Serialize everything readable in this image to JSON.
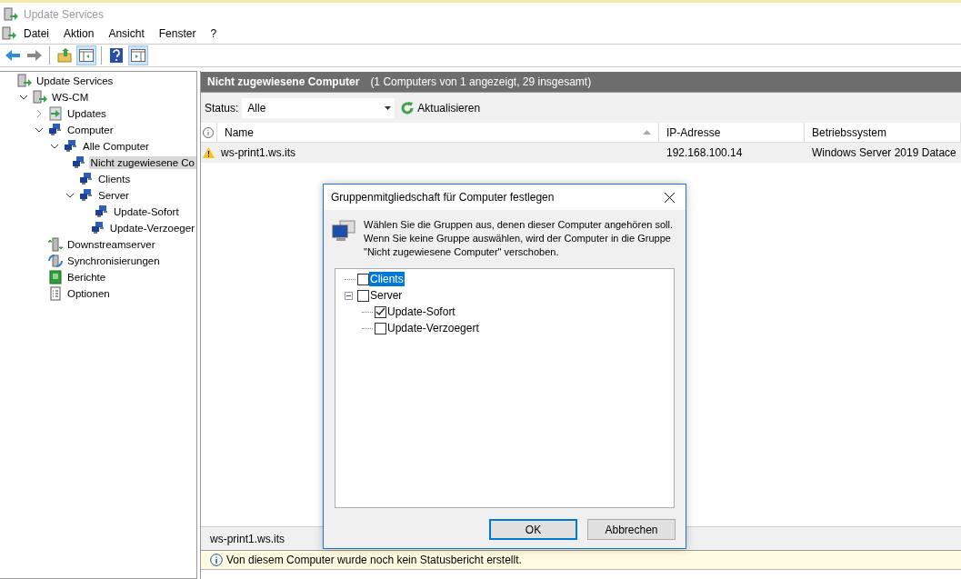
{
  "window": {
    "title": "Update Services"
  },
  "menu": [
    "Datei",
    "Aktion",
    "Ansicht",
    "Fenster",
    "?"
  ],
  "toolbar": [
    {
      "kind": "back",
      "selected": false
    },
    {
      "kind": "forward",
      "selected": false
    },
    {
      "kind": "up",
      "selected": false
    },
    {
      "kind": "pane",
      "selected": true
    },
    {
      "kind": "help",
      "selected": false
    },
    {
      "kind": "action",
      "selected": true
    }
  ],
  "tree": [
    {
      "label": "Update Services",
      "kind": "server",
      "selected": false,
      "children": [
        {
          "label": "WS-CM",
          "kind": "server",
          "selected": false,
          "expanded": true,
          "children": [
            {
              "label": "Updates",
              "kind": "updates",
              "selected": false,
              "expanded": false
            },
            {
              "label": "Computer",
              "kind": "group",
              "selected": false,
              "expanded": true,
              "children": [
                {
                  "label": "Alle Computer",
                  "kind": "group",
                  "selected": false,
                  "expanded": true,
                  "children": [
                    {
                      "label": "Nicht zugewiesene Co",
                      "kind": "group",
                      "selected": true
                    },
                    {
                      "label": "Clients",
                      "kind": "group",
                      "selected": false
                    },
                    {
                      "label": "Server",
                      "kind": "group",
                      "selected": false,
                      "expanded": true,
                      "children": [
                        {
                          "label": "Update-Sofort",
                          "kind": "group",
                          "selected": false
                        },
                        {
                          "label": "Update-Verzoeger",
                          "kind": "group",
                          "selected": false
                        }
                      ]
                    }
                  ]
                }
              ]
            },
            {
              "label": "Downstreamserver",
              "kind": "downstream",
              "selected": false
            },
            {
              "label": "Synchronisierungen",
              "kind": "sync",
              "selected": false
            },
            {
              "label": "Berichte",
              "kind": "reports",
              "selected": false
            },
            {
              "label": "Optionen",
              "kind": "options",
              "selected": false
            }
          ]
        }
      ]
    }
  ],
  "panel": {
    "title": "Nicht zugewiesene Computer",
    "subtitle": "(1 Computers von 1 angezeigt, 29 insgesamt)",
    "status_label": "Status:",
    "status_value": "Alle",
    "refresh": "Aktualisieren",
    "columns": [
      "Name",
      "IP-Adresse",
      "Betriebssystem"
    ],
    "rows": [
      {
        "name": "ws-print1.ws.its",
        "ip": "192.168.100.14",
        "os": "Windows Server 2019 Datace",
        "selected": true
      }
    ],
    "details_title": "ws-print1.ws.its",
    "info": "Von diesem Computer wurde noch kein Statusbericht erstellt."
  },
  "dialog": {
    "title": "Gruppenmitgliedschaft für Computer festlegen",
    "message": "Wählen Sie die Gruppen aus, denen dieser Computer angehören soll. Wenn Sie keine Gruppe auswählen, wird der Computer in die Gruppe \"Nicht zugewiesene Computer\" verschoben.",
    "groups": [
      {
        "label": "Clients",
        "checked": false,
        "selected": true
      },
      {
        "label": "Server",
        "checked": false,
        "selected": false,
        "expanded": true,
        "children": [
          {
            "label": "Update-Sofort",
            "checked": true,
            "selected": false
          },
          {
            "label": "Update-Verzoegert",
            "checked": false,
            "selected": false
          }
        ]
      }
    ],
    "buttons": [
      {
        "label": "OK",
        "default": true
      },
      {
        "label": "Abbrechen",
        "default": false
      }
    ]
  }
}
